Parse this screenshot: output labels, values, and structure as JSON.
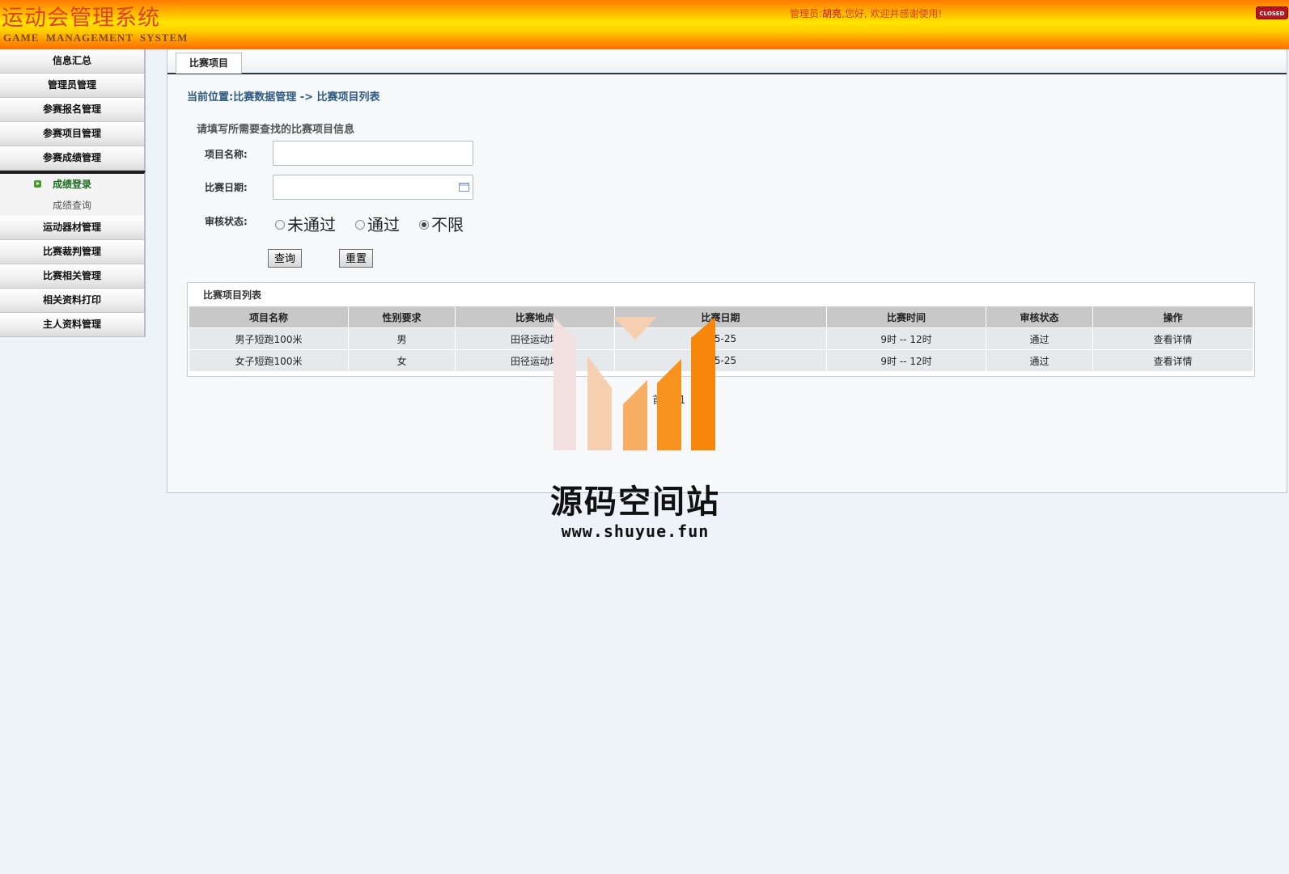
{
  "header": {
    "title": "运动会管理系统",
    "subtitle": "GAME MANAGEMENT SYSTEM",
    "greeting_prefix": "管理员:",
    "user_name": "胡亮",
    "greeting_suffix": ",您好, 欢迎并感谢使用!",
    "closed_label": "CLOSED",
    "gradient_colors": [
      "#ff7a00",
      "#ffe400",
      "#ff6e00"
    ]
  },
  "sidebar": {
    "items": [
      {
        "label": "信息汇总"
      },
      {
        "label": "管理员管理"
      },
      {
        "label": "参赛报名管理"
      },
      {
        "label": "参赛项目管理"
      },
      {
        "label": "参赛成绩管理"
      }
    ],
    "submenu": [
      {
        "label": "成绩登录",
        "active": true
      },
      {
        "label": "成绩查询",
        "active": false
      }
    ],
    "items_after": [
      {
        "label": "运动器材管理"
      },
      {
        "label": "比赛裁判管理"
      },
      {
        "label": "比赛相关管理"
      },
      {
        "label": "相关资料打印"
      },
      {
        "label": "主人资料管理"
      }
    ]
  },
  "tab": {
    "label": "比赛项目"
  },
  "breadcrumb": "当前位置:比赛数据管理 -> 比赛项目列表",
  "search": {
    "title": "请填写所需要查找的比赛项目信息",
    "name_label": "项目名称:",
    "name_value": "",
    "date_label": "比赛日期:",
    "date_value": "",
    "status_label": "审核状态:",
    "status_options": [
      "未通过",
      "通过",
      "不限"
    ],
    "status_selected": "不限",
    "query_button": "查询",
    "reset_button": "重置"
  },
  "list": {
    "title": "比赛项目列表",
    "columns": [
      "项目名称",
      "性别要求",
      "比赛地点",
      "比赛日期",
      "比赛时间",
      "审核状态",
      "操作"
    ],
    "rows": [
      [
        "男子短跑100米",
        "男",
        "田径运动场",
        "-05-25",
        "9时 -- 12时",
        "通过",
        "查看详情"
      ],
      [
        "女子短跑100米",
        "女",
        "田径运动场",
        "-05-25",
        "9时 -- 12时",
        "通过",
        "查看详情"
      ]
    ]
  },
  "pager": {
    "first": "首页",
    "page": "1",
    "last": "尾页"
  },
  "watermark": {
    "text": "源码空间站",
    "url": "www.shuyue.fun",
    "colors": [
      "#f3e1e1",
      "#f6cfb1",
      "#f7ad62",
      "#f7921e",
      "#f7870a"
    ]
  }
}
